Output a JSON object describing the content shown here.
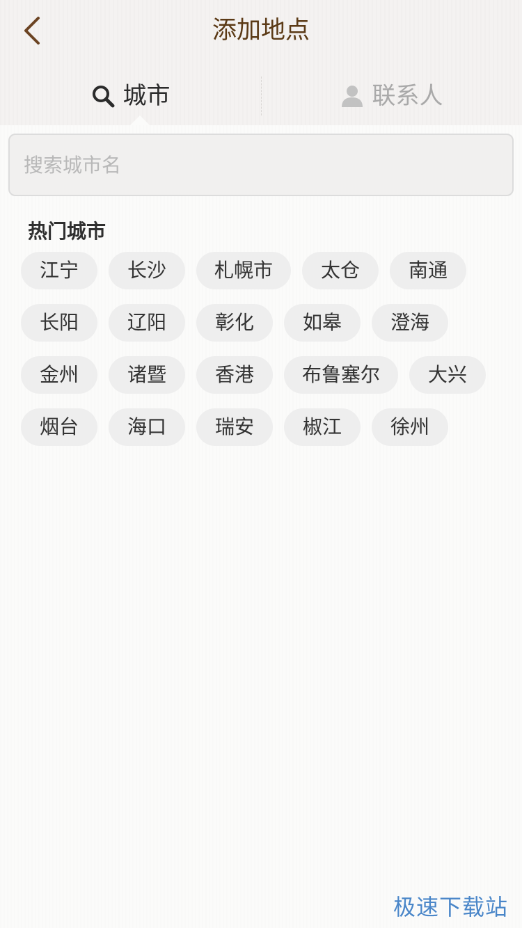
{
  "header": {
    "title": "添加地点",
    "back_icon": "chevron-left-icon",
    "colors": {
      "title": "#5b3a16",
      "header_bg": "#f4f2f1"
    }
  },
  "tabs": [
    {
      "label": "城市",
      "icon": "search-icon",
      "active": true
    },
    {
      "label": "联系人",
      "icon": "person-icon",
      "active": false
    }
  ],
  "search": {
    "placeholder": "搜索城市名",
    "value": ""
  },
  "hot_cities": {
    "title": "热门城市",
    "items": [
      "江宁",
      "长沙",
      "札幌市",
      "太仓",
      "南通",
      "长阳",
      "辽阳",
      "彰化",
      "如皋",
      "澄海",
      "金州",
      "诸暨",
      "香港",
      "布鲁塞尔",
      "大兴",
      "烟台",
      "海口",
      "瑞安",
      "椒江",
      "徐州"
    ]
  },
  "watermark": "极速下载站"
}
